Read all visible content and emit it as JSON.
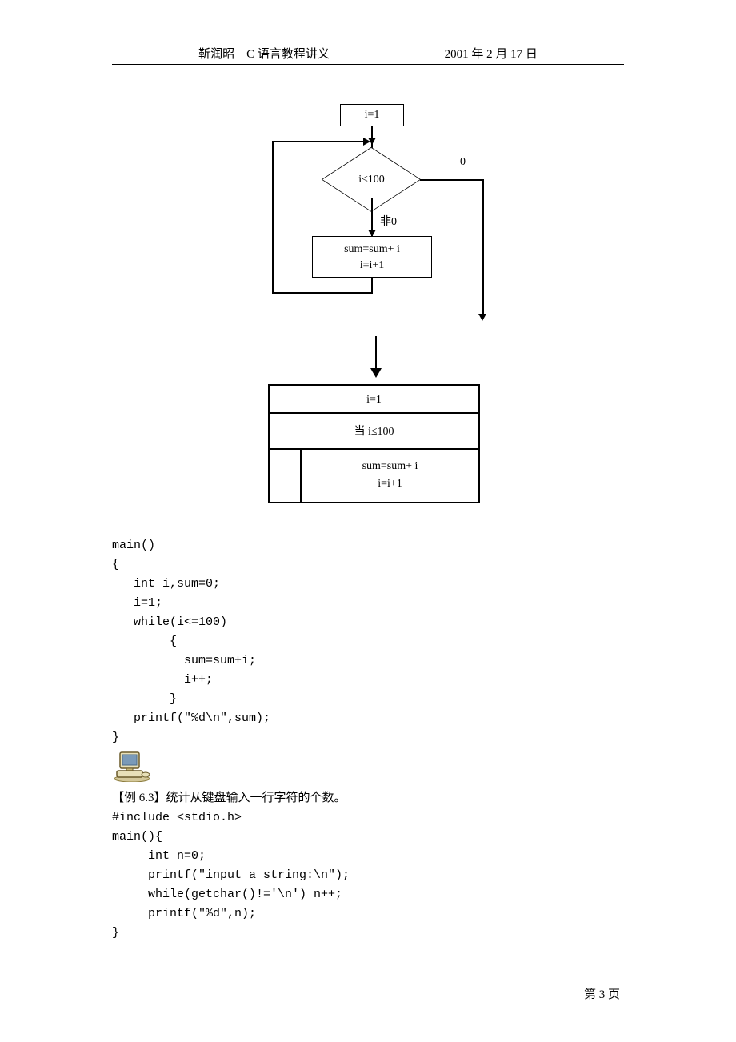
{
  "header": {
    "author": "靳润昭",
    "title": "C 语言教程讲义",
    "date": "2001 年 2 月 17 日"
  },
  "flowchart": {
    "init": "i=1",
    "condition": "i≤100",
    "true_label": "非0",
    "false_label": "0",
    "process_line1": "sum=sum+ i",
    "process_line2": "i=i+1"
  },
  "ns_chart": {
    "row1": "i=1",
    "row2": "当 i≤100",
    "row3_line1": "sum=sum+ i",
    "row3_line2": "i=i+1"
  },
  "code1": {
    "line1": "main()",
    "line2": "{",
    "line3": "   int i,sum=0;",
    "line4": "   i=1;",
    "line5": "   while(i<=100)",
    "line6": "        {",
    "line7": "          sum=sum+i;",
    "line8": "          i++;",
    "line9": "        }",
    "line10": "   printf(\"%d\\n\",sum);",
    "line11": "}"
  },
  "example_title": "【例 6.3】统计从键盘输入一行字符的个数。",
  "code2": {
    "line1": "#include <stdio.h>",
    "line2": "main(){",
    "line3": "     int n=0;",
    "line4": "     printf(\"input a string:\\n\");",
    "line5": "     while(getchar()!='\\n') n++;",
    "line6": "     printf(\"%d\",n);",
    "line7": "}"
  },
  "footer": {
    "page": "第 3 页"
  }
}
